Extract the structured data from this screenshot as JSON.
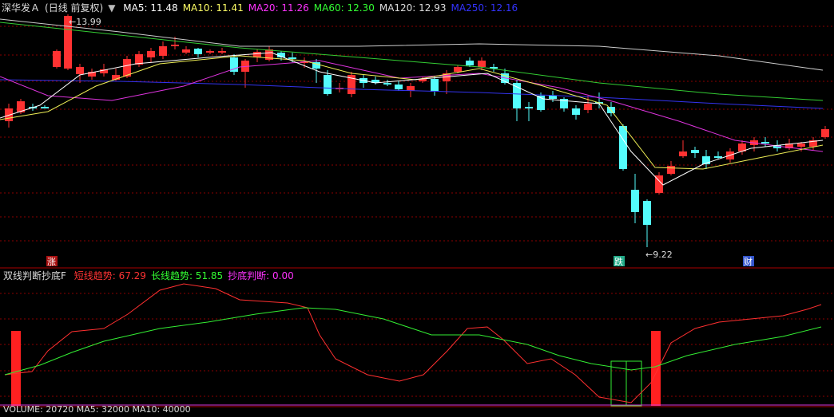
{
  "header": {
    "stock": "深华发Ａ",
    "period": "(日线 前复权)",
    "ma": [
      {
        "label": "MA5: 11.48",
        "color": "#ffffff"
      },
      {
        "label": "MA10: 11.41",
        "color": "#ffff66"
      },
      {
        "label": "MA20: 11.26",
        "color": "#ff33ff"
      },
      {
        "label": "MA60: 12.30",
        "color": "#33ff33"
      },
      {
        "label": "MA120: 12.93",
        "color": "#dddddd"
      },
      {
        "label": "MA250: 12.16",
        "color": "#3333ff"
      }
    ]
  },
  "price_panel": {
    "high_label": "13.99",
    "low_label": "9.22",
    "markers": [
      "涨",
      "跌",
      "财"
    ]
  },
  "indicator": {
    "name": "双线判断抄底F",
    "items": [
      {
        "label": "短线趋势: 67.29",
        "color": "#ff3333"
      },
      {
        "label": "长线趋势: 51.85",
        "color": "#33ff33"
      },
      {
        "label": "抄底判断: 0.00",
        "color": "#ff33ff"
      }
    ]
  },
  "volume_panel": {
    "label": "VOLUME: 20720  MA5: 32000  MA10: 40000"
  },
  "colors": {
    "up": "#ff3232",
    "down": "#54fcfc",
    "grid": "#8b0000",
    "border": "#aa0000"
  }
}
